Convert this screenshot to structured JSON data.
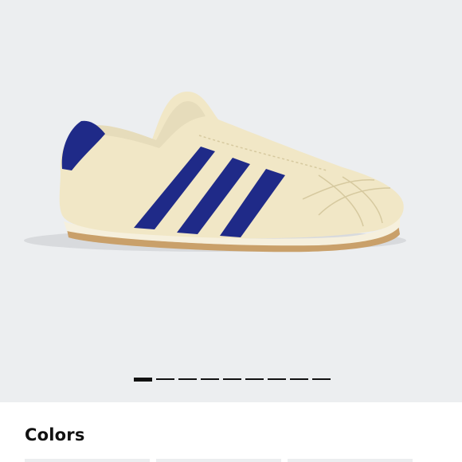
{
  "gallery": {
    "background_color": "#eceef0",
    "image_icon": "sneaker-product-image",
    "shoe_colors": {
      "leather": "#f1e7c6",
      "stripes": "#1f2a88",
      "heel_tab": "#1f2a88",
      "sole": "#c9a06a"
    },
    "pagination": {
      "total": 9,
      "active_index": 0
    }
  },
  "colors_section": {
    "title": "Colors"
  }
}
